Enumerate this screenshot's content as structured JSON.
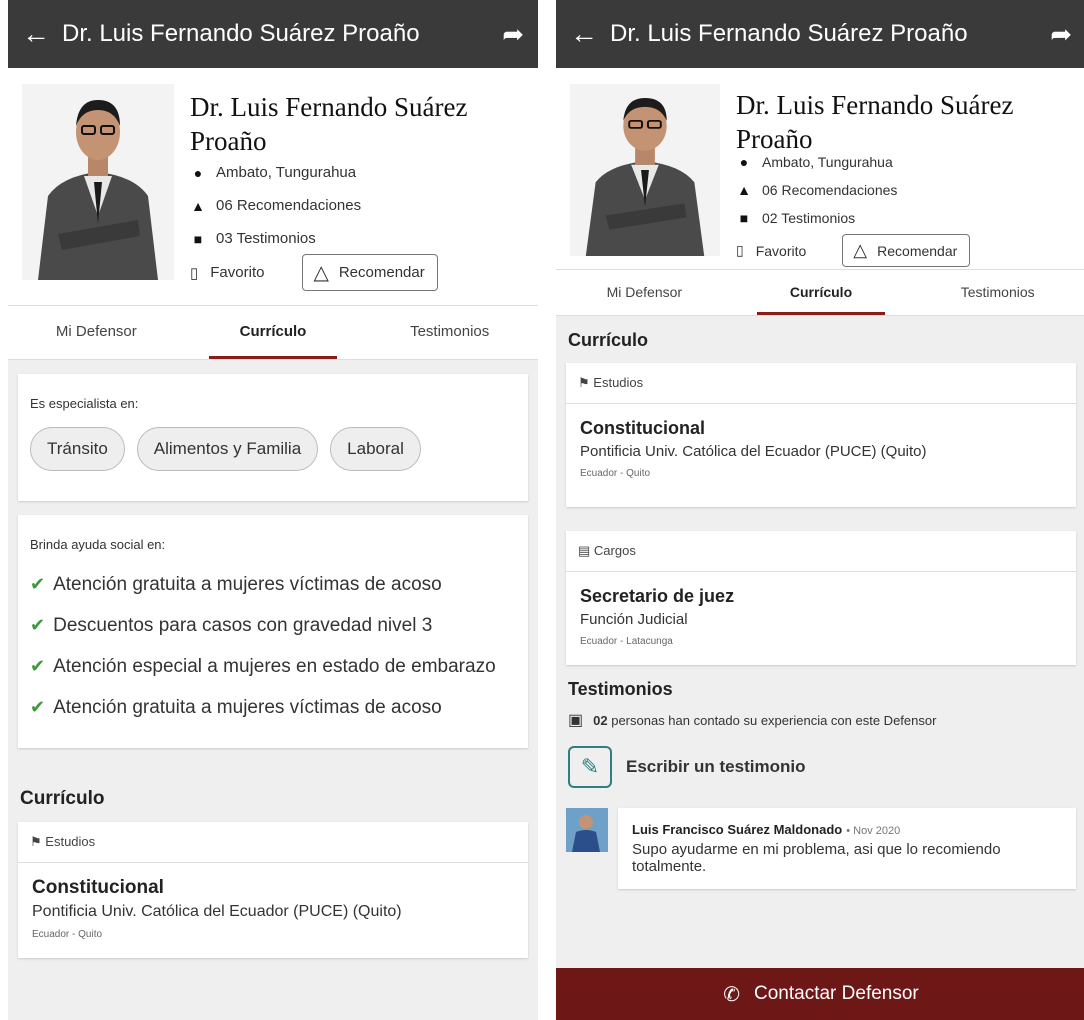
{
  "colors": {
    "appbar": "#3a3a3a",
    "accent": "#8b1c1c",
    "contact_bg": "#6e1717",
    "check": "#3c9a3c",
    "write_icon": "#2f7f7f"
  },
  "left": {
    "appbar": {
      "back_icon": "arrow-left-icon",
      "title": "Dr. Luis Fernando Suárez Proaño",
      "share_icon": "share-icon"
    },
    "profile": {
      "name": "Dr. Luis Fernando Suárez Proaño",
      "location": "Ambato, Tungurahua",
      "recommendations": "06 Recomendaciones",
      "testimonials": "03 Testimonios",
      "favorite_label": "Favorito",
      "recommend_label": "Recomendar"
    },
    "tabs": [
      "Mi Defensor",
      "Currículo",
      "Testimonios"
    ],
    "specialist": {
      "label": "Es especialista en:",
      "chips": [
        "Tránsito",
        "Alimentos y Familia",
        "Laboral"
      ]
    },
    "social": {
      "label": "Brinda ayuda social en:",
      "items": [
        "Atención gratuita a mujeres víctimas de acoso",
        "Descuentos para casos con gravedad nivel 3",
        "Atención especial a mujeres en estado de embarazo",
        "Atención gratuita a mujeres víctimas de acoso"
      ]
    },
    "curriculo": {
      "title": "Currículo",
      "studies_label": "Estudios",
      "study": {
        "title": "Constitucional",
        "institution": "Pontificia Univ. Católica del Ecuador (PUCE) (Quito)",
        "location": "Ecuador - Quito"
      }
    }
  },
  "right": {
    "appbar": {
      "title": "Dr. Luis Fernando Suárez Proaño"
    },
    "profile": {
      "name": "Dr. Luis Fernando Suárez Proaño",
      "location": "Ambato, Tungurahua",
      "recommendations": "06 Recomendaciones",
      "testimonials": "02 Testimonios",
      "favorite_label": "Favorito",
      "recommend_label": "Recomendar"
    },
    "tabs": [
      "Mi Defensor",
      "Currículo",
      "Testimonios"
    ],
    "curriculo": {
      "title": "Currículo",
      "studies_label": "Estudios",
      "study": {
        "title": "Constitucional",
        "institution": "Pontificia Univ. Católica del Ecuador (PUCE) (Quito)",
        "location": "Ecuador - Quito"
      },
      "jobs_label": "Cargos",
      "job": {
        "title": "Secretario de juez",
        "institution": "Función Judicial",
        "location": "Ecuador - Latacunga"
      }
    },
    "testimonios": {
      "title": "Testimonios",
      "count": "02",
      "count_text": "personas han contado su experiencia con este Defensor",
      "write_label": "Escribir un testimonio",
      "review": {
        "author": "Luis Francisco Suárez Maldonado",
        "date": "• Nov 2020",
        "text": "Supo ayudarme en mi problema, asi que lo recomiendo totalmente."
      }
    },
    "contact_label": "Contactar Defensor"
  }
}
